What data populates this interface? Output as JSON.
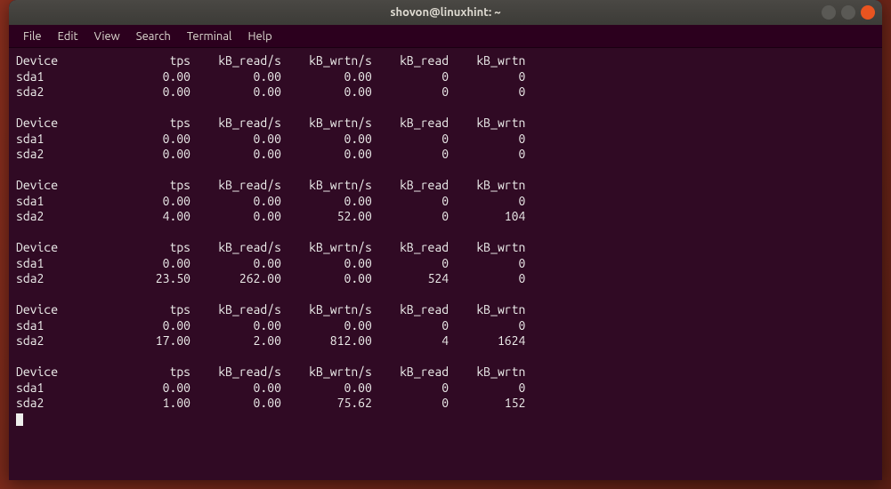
{
  "window": {
    "title": "shovon@linuxhint: ~"
  },
  "menu": {
    "items": [
      "File",
      "Edit",
      "View",
      "Search",
      "Terminal",
      "Help"
    ]
  },
  "terminal": {
    "header_cols": [
      "Device",
      "tps",
      "kB_read/s",
      "kB_wrtn/s",
      "kB_read",
      "kB_wrtn"
    ],
    "blocks": [
      {
        "rows": [
          {
            "device": "sda1",
            "tps": "0.00",
            "kB_read_s": "0.00",
            "kB_wrtn_s": "0.00",
            "kB_read": "0",
            "kB_wrtn": "0"
          },
          {
            "device": "sda2",
            "tps": "0.00",
            "kB_read_s": "0.00",
            "kB_wrtn_s": "0.00",
            "kB_read": "0",
            "kB_wrtn": "0"
          }
        ]
      },
      {
        "rows": [
          {
            "device": "sda1",
            "tps": "0.00",
            "kB_read_s": "0.00",
            "kB_wrtn_s": "0.00",
            "kB_read": "0",
            "kB_wrtn": "0"
          },
          {
            "device": "sda2",
            "tps": "0.00",
            "kB_read_s": "0.00",
            "kB_wrtn_s": "0.00",
            "kB_read": "0",
            "kB_wrtn": "0"
          }
        ]
      },
      {
        "rows": [
          {
            "device": "sda1",
            "tps": "0.00",
            "kB_read_s": "0.00",
            "kB_wrtn_s": "0.00",
            "kB_read": "0",
            "kB_wrtn": "0"
          },
          {
            "device": "sda2",
            "tps": "4.00",
            "kB_read_s": "0.00",
            "kB_wrtn_s": "52.00",
            "kB_read": "0",
            "kB_wrtn": "104"
          }
        ]
      },
      {
        "rows": [
          {
            "device": "sda1",
            "tps": "0.00",
            "kB_read_s": "0.00",
            "kB_wrtn_s": "0.00",
            "kB_read": "0",
            "kB_wrtn": "0"
          },
          {
            "device": "sda2",
            "tps": "23.50",
            "kB_read_s": "262.00",
            "kB_wrtn_s": "0.00",
            "kB_read": "524",
            "kB_wrtn": "0"
          }
        ]
      },
      {
        "rows": [
          {
            "device": "sda1",
            "tps": "0.00",
            "kB_read_s": "0.00",
            "kB_wrtn_s": "0.00",
            "kB_read": "0",
            "kB_wrtn": "0"
          },
          {
            "device": "sda2",
            "tps": "17.00",
            "kB_read_s": "2.00",
            "kB_wrtn_s": "812.00",
            "kB_read": "4",
            "kB_wrtn": "1624"
          }
        ]
      },
      {
        "rows": [
          {
            "device": "sda1",
            "tps": "0.00",
            "kB_read_s": "0.00",
            "kB_wrtn_s": "0.00",
            "kB_read": "0",
            "kB_wrtn": "0"
          },
          {
            "device": "sda2",
            "tps": "1.00",
            "kB_read_s": "0.00",
            "kB_wrtn_s": "75.62",
            "kB_read": "0",
            "kB_wrtn": "152"
          }
        ]
      }
    ]
  }
}
